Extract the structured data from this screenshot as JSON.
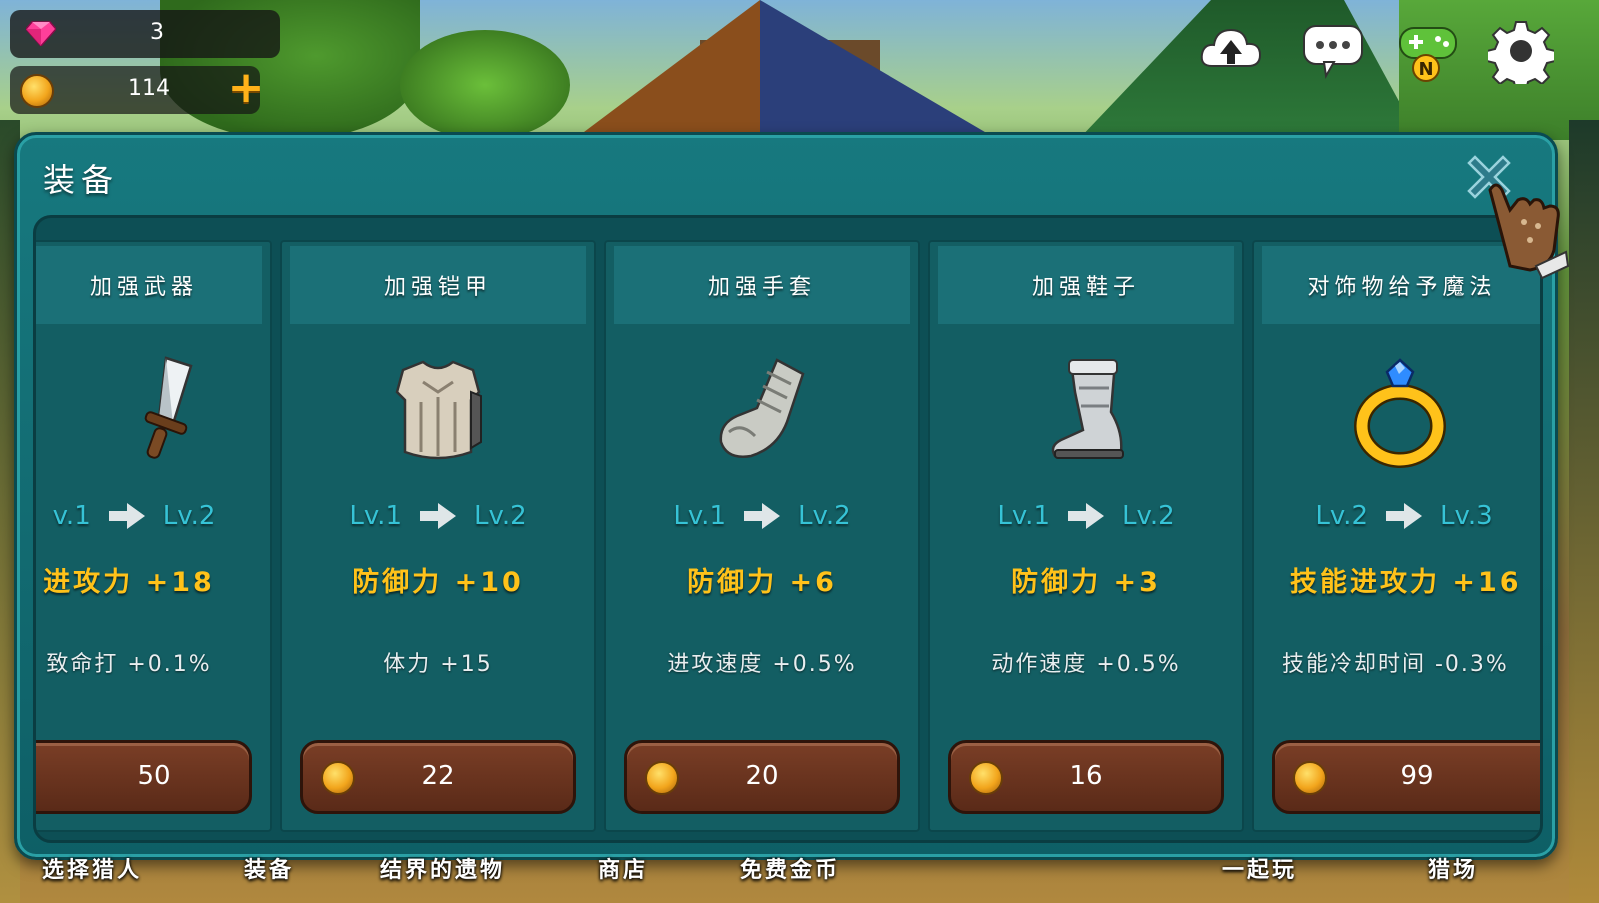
{
  "currency": {
    "gems": "3",
    "coins": "114",
    "add_label": "+"
  },
  "top_icons": [
    "cloud-upload-icon",
    "chat-icon",
    "gamepad-icon",
    "gear-icon"
  ],
  "gamepad_badge": "N",
  "panel": {
    "title": "装备"
  },
  "cards": [
    {
      "title": "加强武器",
      "icon": "dagger-icon",
      "lv_from": "v.1",
      "lv_to": "Lv.2",
      "stat_main": "进攻力 +18",
      "stat_sub": "致命打 +0.1%",
      "price": "50"
    },
    {
      "title": "加强铠甲",
      "icon": "armor-icon",
      "lv_from": "Lv.1",
      "lv_to": "Lv.2",
      "stat_main": "防御力 +10",
      "stat_sub": "体力 +15",
      "price": "22"
    },
    {
      "title": "加强手套",
      "icon": "gauntlet-icon",
      "lv_from": "Lv.1",
      "lv_to": "Lv.2",
      "stat_main": "防御力 +6",
      "stat_sub": "进攻速度 +0.5%",
      "price": "20"
    },
    {
      "title": "加强鞋子",
      "icon": "boot-icon",
      "lv_from": "Lv.1",
      "lv_to": "Lv.2",
      "stat_main": "防御力 +3",
      "stat_sub": "动作速度 +0.5%",
      "price": "16"
    },
    {
      "title": "对饰物给予魔法",
      "icon": "ring-icon",
      "lv_from": "Lv.2",
      "lv_to": "Lv.3",
      "stat_main": "技能进攻力 +16",
      "stat_sub": "技能冷却时间 -0.3%",
      "price": "99"
    }
  ],
  "bottom_nav": [
    "选择猎人",
    "装备",
    "结界的遗物",
    "商店",
    "免费金币",
    "一起玩",
    "猎场"
  ],
  "colors": {
    "panel": "#17797f",
    "level_text": "#36c3d6",
    "stat_gold": "#ffc21a",
    "price_button": "#6a3220"
  }
}
